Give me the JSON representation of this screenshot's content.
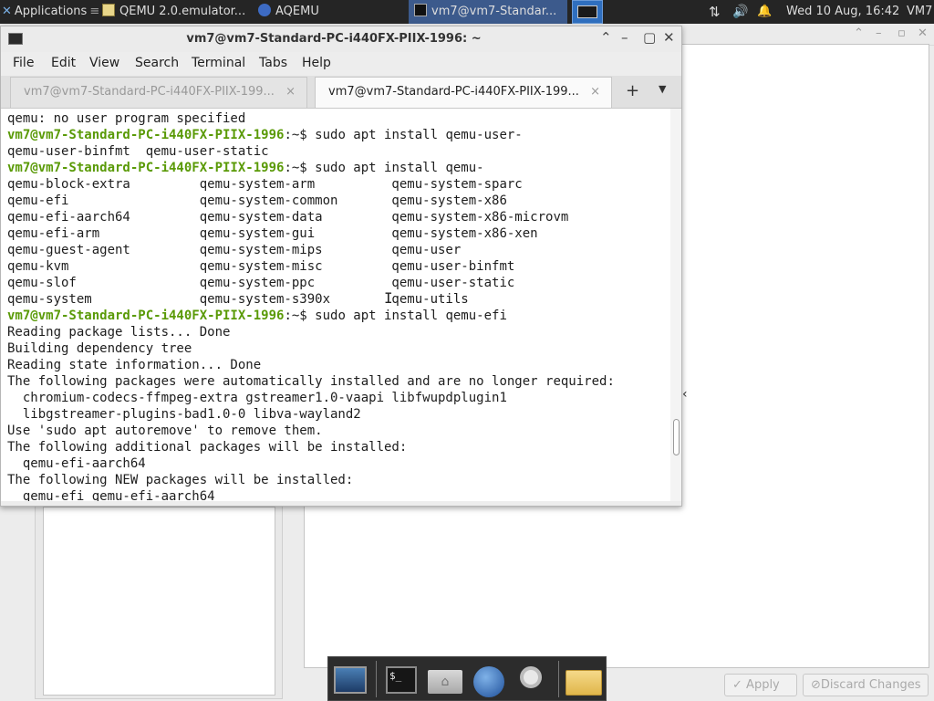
{
  "panel": {
    "applications_label": "Applications",
    "tasks": [
      {
        "label": "QEMU 2.0.emulator..."
      },
      {
        "label": "AQEMU"
      },
      {
        "label": "vm7@vm7-Standar..."
      }
    ],
    "clock": "Wed 10 Aug, 16:42",
    "user": "VM7"
  },
  "terminal": {
    "title": "vm7@vm7-Standard-PC-i440FX-PIIX-1996: ~",
    "menu": [
      "File",
      "Edit",
      "View",
      "Search",
      "Terminal",
      "Tabs",
      "Help"
    ],
    "tabs": [
      {
        "label": "vm7@vm7-Standard-PC-i440FX-PIIX-199..."
      },
      {
        "label": "vm7@vm7-Standard-PC-i440FX-PIIX-199..."
      }
    ],
    "prompt": "vm7@vm7-Standard-PC-i440FX-PIIX-1996",
    "lines": [
      {
        "text": "qemu: no user program specified"
      },
      {
        "prompt": "vm7@vm7-Standard-PC-i440FX-PIIX-1996",
        "text": ":~$ sudo apt install qemu-user-"
      },
      {
        "text": "qemu-user-binfmt  qemu-user-static"
      },
      {
        "prompt": "vm7@vm7-Standard-PC-i440FX-PIIX-1996",
        "text": ":~$ sudo apt install qemu-"
      },
      {
        "text": "qemu-block-extra         qemu-system-arm          qemu-system-sparc"
      },
      {
        "text": "qemu-efi                 qemu-system-common       qemu-system-x86"
      },
      {
        "text": "qemu-efi-aarch64         qemu-system-data         qemu-system-x86-microvm"
      },
      {
        "text": "qemu-efi-arm             qemu-system-gui          qemu-system-x86-xen"
      },
      {
        "text": "qemu-guest-agent         qemu-system-mips         qemu-user"
      },
      {
        "text": "qemu-kvm                 qemu-system-misc         qemu-user-binfmt"
      },
      {
        "text": "qemu-slof                qemu-system-ppc          qemu-user-static"
      },
      {
        "text": "qemu-system              qemu-system-s390x        qemu-utils"
      },
      {
        "prompt": "vm7@vm7-Standard-PC-i440FX-PIIX-1996",
        "text": ":~$ sudo apt install qemu-efi"
      },
      {
        "text": "Reading package lists... Done"
      },
      {
        "text": "Building dependency tree"
      },
      {
        "text": "Reading state information... Done"
      },
      {
        "text": "The following packages were automatically installed and are no longer required:"
      },
      {
        "text": "  chromium-codecs-ffmpeg-extra gstreamer1.0-vaapi libfwupdplugin1"
      },
      {
        "text": "  libgstreamer-plugins-bad1.0-0 libva-wayland2"
      },
      {
        "text": "Use 'sudo apt autoremove' to remove them."
      },
      {
        "text": "The following additional packages will be installed:"
      },
      {
        "text": "  qemu-efi-aarch64"
      },
      {
        "text": "The following NEW packages will be installed:"
      },
      {
        "text": "  qemu-efi qemu-efi-aarch64"
      }
    ]
  },
  "aqemu": {
    "apply_label": "Apply",
    "discard_label": "Discard Changes"
  },
  "dock": {
    "items": [
      "desktop-icon",
      "terminal-icon",
      "home-folder-icon",
      "web-browser-icon",
      "search-icon",
      "files-icon"
    ]
  },
  "colors": {
    "panel_bg": "#252525",
    "prompt_green": "#5a9a07",
    "active_task_bg": "#3c5a8c"
  }
}
